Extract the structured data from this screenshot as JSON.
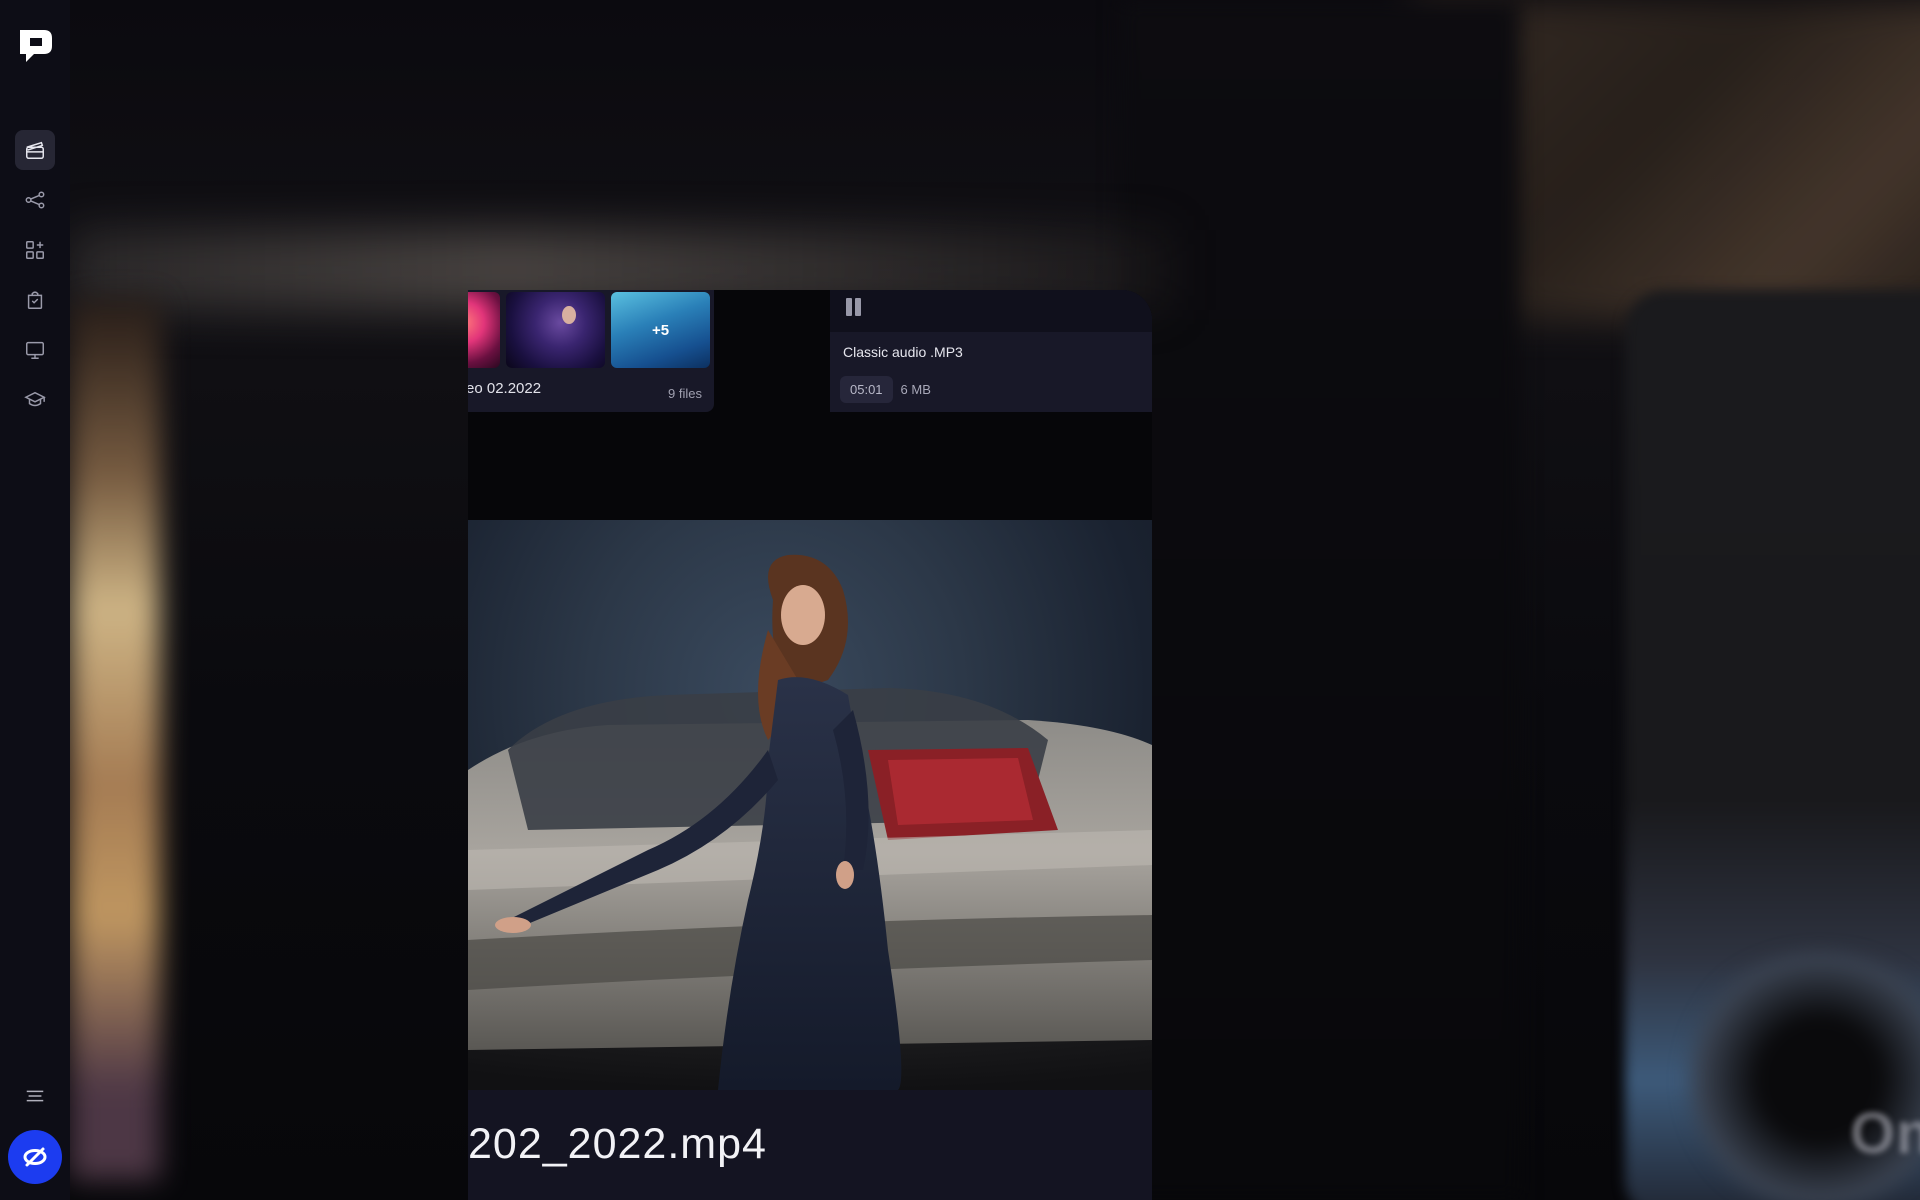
{
  "sidebar": {
    "logo": "app-logo",
    "items": [
      {
        "name": "projects",
        "icon": "clapperboard-icon",
        "active": true
      },
      {
        "name": "share",
        "icon": "share-nodes-icon",
        "active": false
      },
      {
        "name": "apps",
        "icon": "apps-add-icon",
        "active": false
      },
      {
        "name": "bag",
        "icon": "bag-icon",
        "active": false
      },
      {
        "name": "monitor",
        "icon": "monitor-icon",
        "active": false
      },
      {
        "name": "learn",
        "icon": "graduation-cap-icon",
        "active": false
      }
    ],
    "menu_icon": "menu-lines-icon",
    "fab_icon": "link-off-icon",
    "accent": "#1c3cf0"
  },
  "folder_card": {
    "name": "eo 02.2022",
    "count": "9 files",
    "more_badge": "+5"
  },
  "audio_card": {
    "title": "Classic audio .MP3",
    "duration": "05:01",
    "size": "6 MB",
    "state_icon": "pause-icon"
  },
  "preview": {
    "file_name": "202_2022.mp4"
  }
}
